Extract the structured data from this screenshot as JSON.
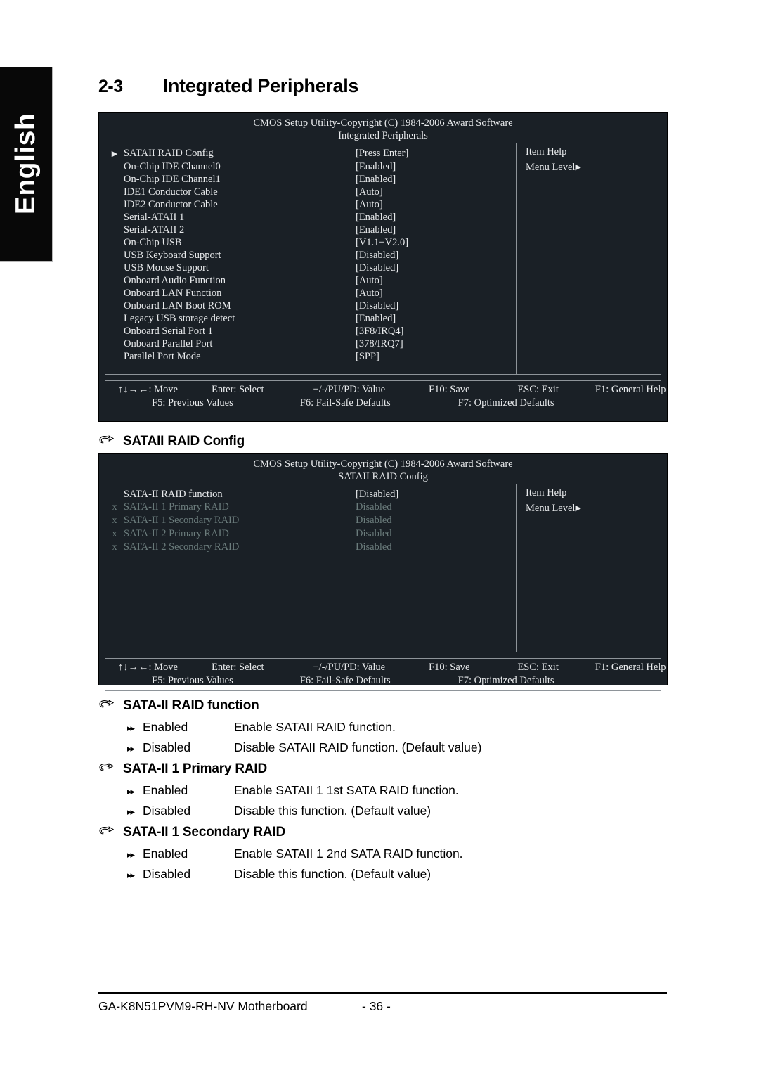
{
  "language_tab": {
    "label": "English"
  },
  "chapter": {
    "number": "2-3",
    "title": "Integrated Peripherals"
  },
  "bios_screen_1": {
    "title": "CMOS Setup Utility-Copyright (C) 1984-2006 Award Software",
    "subtitle": "Integrated Peripherals",
    "items": [
      {
        "marker": "▶",
        "name": "SATAII RAID Config",
        "value": "[Press Enter]"
      },
      {
        "marker": "",
        "name": "On-Chip IDE Channel0",
        "value": "[Enabled]"
      },
      {
        "marker": "",
        "name": "On-Chip IDE Channel1",
        "value": "[Enabled]"
      },
      {
        "marker": "",
        "name": "IDE1 Conductor Cable",
        "value": "[Auto]"
      },
      {
        "marker": "",
        "name": "IDE2 Conductor Cable",
        "value": "[Auto]"
      },
      {
        "marker": "",
        "name": "Serial-ATAII 1",
        "value": "[Enabled]"
      },
      {
        "marker": "",
        "name": "Serial-ATAII 2",
        "value": "[Enabled]"
      },
      {
        "marker": "",
        "name": "On-Chip USB",
        "value": "[V1.1+V2.0]"
      },
      {
        "marker": "",
        "name": "USB Keyboard Support",
        "value": "[Disabled]"
      },
      {
        "marker": "",
        "name": "USB Mouse Support",
        "value": "[Disabled]"
      },
      {
        "marker": "",
        "name": "Onboard Audio Function",
        "value": "[Auto]"
      },
      {
        "marker": "",
        "name": "Onboard LAN Function",
        "value": "[Auto]"
      },
      {
        "marker": "",
        "name": "Onboard LAN Boot ROM",
        "value": "[Disabled]"
      },
      {
        "marker": "",
        "name": "Legacy USB storage detect",
        "value": "[Enabled]"
      },
      {
        "marker": "",
        "name": "Onboard Serial Port 1",
        "value": "[3F8/IRQ4]"
      },
      {
        "marker": "",
        "name": "Onboard Parallel Port",
        "value": "[378/IRQ7]"
      },
      {
        "marker": "",
        "name": "Parallel Port Mode",
        "value": "[SPP]"
      }
    ],
    "help": {
      "title": "Item Help",
      "menu_level": "Menu Level",
      "arrow": "▶"
    },
    "keys": {
      "move": "↑↓→←: Move",
      "select": "Enter: Select",
      "value": "+/-/PU/PD: Value",
      "save": "F10: Save",
      "exit": "ESC: Exit",
      "general_help": "F1: General Help",
      "previous_values": "F5: Previous Values",
      "fail_safe": "F6: Fail-Safe Defaults",
      "optimized": "F7: Optimized Defaults"
    }
  },
  "section_raid_config": {
    "heading": "SATAII RAID Config",
    "icon": "pointing-hand"
  },
  "bios_screen_2": {
    "title": "CMOS Setup Utility-Copyright (C) 1984-2006 Award Software",
    "subtitle": "SATAII RAID Config",
    "items": [
      {
        "marker": "",
        "name": "SATA-II RAID function",
        "value": "[Disabled]",
        "dim": false
      },
      {
        "marker": "x",
        "name": "SATA-II 1 Primary RAID",
        "value": "Disabled",
        "dim": true
      },
      {
        "marker": "x",
        "name": "SATA-II 1 Secondary RAID",
        "value": "Disabled",
        "dim": true
      },
      {
        "marker": "x",
        "name": "SATA-II 2 Primary RAID",
        "value": "Disabled",
        "dim": true
      },
      {
        "marker": "x",
        "name": "SATA-II 2 Secondary RAID",
        "value": "Disabled",
        "dim": true
      }
    ],
    "help": {
      "title": "Item Help",
      "menu_level": "Menu Level",
      "arrow": "▶"
    },
    "keys": {
      "move": "↑↓→←: Move",
      "select": "Enter: Select",
      "value": "+/-/PU/PD: Value",
      "save": "F10: Save",
      "exit": "ESC: Exit",
      "general_help": "F1: General Help",
      "previous_values": "F5: Previous Values",
      "fail_safe": "F6: Fail-Safe Defaults",
      "optimized": "F7: Optimized Defaults"
    }
  },
  "descriptions": [
    {
      "heading": "SATA-II RAID function",
      "options": [
        {
          "bullet": "▸▸",
          "label": "Enabled",
          "desc": "Enable SATAII RAID function."
        },
        {
          "bullet": "▸▸",
          "label": "Disabled",
          "desc": "Disable SATAII RAID function. (Default value)"
        }
      ]
    },
    {
      "heading": "SATA-II 1 Primary RAID",
      "options": [
        {
          "bullet": "▸▸",
          "label": "Enabled",
          "desc": "Enable SATAII 1 1st SATA RAID function."
        },
        {
          "bullet": "▸▸",
          "label": "Disabled",
          "desc": "Disable this function. (Default value)"
        }
      ]
    },
    {
      "heading": "SATA-II 1 Secondary RAID",
      "options": [
        {
          "bullet": "▸▸",
          "label": "Enabled",
          "desc": "Enable SATAII 1 2nd SATA RAID function."
        },
        {
          "bullet": "▸▸",
          "label": "Disabled",
          "desc": "Disable this function. (Default value)"
        }
      ]
    }
  ],
  "page_footer": {
    "model": "GA-K8N51PVM9-RH-NV Motherboard",
    "page_number": "- 36 -"
  }
}
